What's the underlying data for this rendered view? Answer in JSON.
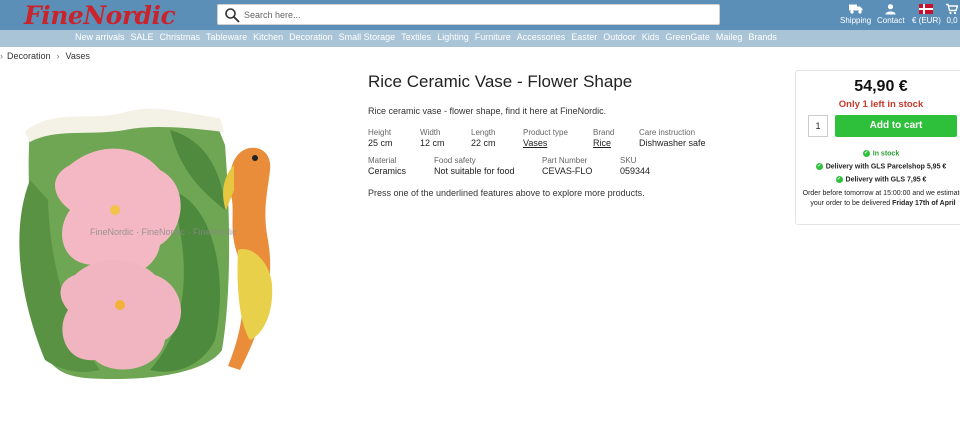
{
  "header": {
    "logo": "FineNordic",
    "search_placeholder": "Search here...",
    "tools": [
      {
        "label": "Shipping",
        "icon": "truck-icon"
      },
      {
        "label": "Contact",
        "icon": "user-icon"
      },
      {
        "label": "€ (EUR)",
        "icon": "flag-dk-icon"
      },
      {
        "label": "0,0",
        "icon": "cart-icon"
      }
    ]
  },
  "nav": [
    "New arrivals",
    "SALE",
    "Christmas",
    "Tableware",
    "Kitchen",
    "Decoration",
    "Small Storage",
    "Textiles",
    "Lighting",
    "Furniture",
    "Accessories",
    "Easter",
    "Outdoor",
    "Kids",
    "GreenGate",
    "Maileg",
    "Brands"
  ],
  "breadcrumb": [
    "Decoration",
    "Vases"
  ],
  "watermark": "FineNordic",
  "product": {
    "title": "Rice Ceramic Vase - Flower Shape",
    "description": "Rice ceramic vase - flower shape, find it here at FineNordic.",
    "specs_row1": [
      {
        "k": "Height",
        "v": "25 cm"
      },
      {
        "k": "Width",
        "v": "12 cm"
      },
      {
        "k": "Length",
        "v": "22 cm"
      },
      {
        "k": "Product type",
        "v": "Vases"
      },
      {
        "k": "Brand",
        "v": "Rice"
      },
      {
        "k": "Care instruction",
        "v": "Dishwasher safe"
      }
    ],
    "specs_row2": [
      {
        "k": "Material",
        "v": "Ceramics"
      },
      {
        "k": "Food safety",
        "v": "Not suitable for food"
      },
      {
        "k": "Part Number",
        "v": "CEVAS-FLO"
      },
      {
        "k": "SKU",
        "v": "059344"
      }
    ],
    "hint": "Press one of the underlined features above to explore more products."
  },
  "buy": {
    "price": "54,90 €",
    "stock_note": "Only 1 left in stock",
    "qty": "1",
    "cart_label": "Add to cart",
    "in_stock": "In stock",
    "delivery1": "Delivery with GLS Parcelshop 5,95 €",
    "delivery2": "Delivery with GLS 7,95 €",
    "order_text": "Order before tomorrow at 15:00:00 and we estimate your order to be delivered",
    "order_date": "Friday 17th of April"
  },
  "colors": {
    "topbar": "#5c8fb8",
    "navbar": "#a9c4d7",
    "logo": "#c9242b",
    "cart": "#2ebf3b",
    "stock": "#c8392b"
  }
}
